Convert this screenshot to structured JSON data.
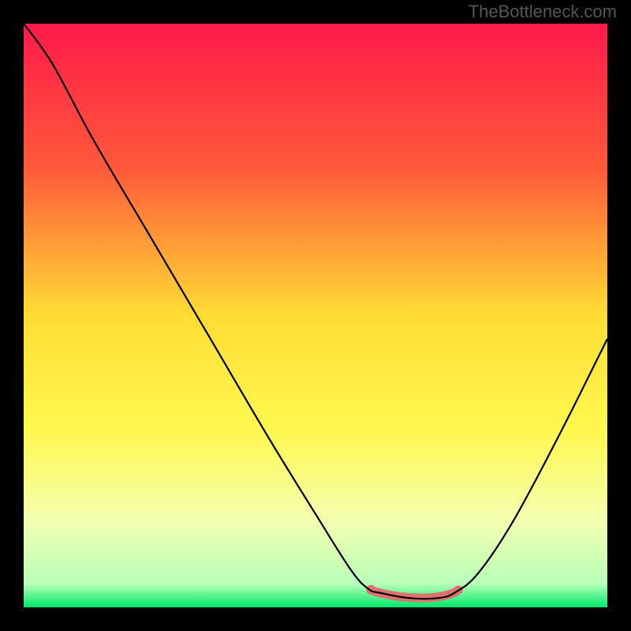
{
  "watermark": "TheBottleneck.com",
  "chart_data": {
    "type": "line",
    "title": "",
    "xlabel": "",
    "ylabel": "",
    "xlim": [
      0,
      100
    ],
    "ylim": [
      0,
      100
    ],
    "gradient_stops": [
      {
        "offset": 0,
        "color": "#ff1a4a"
      },
      {
        "offset": 25,
        "color": "#ff5a3a"
      },
      {
        "offset": 50,
        "color": "#ffdd33"
      },
      {
        "offset": 70,
        "color": "#fff850"
      },
      {
        "offset": 85,
        "color": "#f4ffb0"
      },
      {
        "offset": 96,
        "color": "#b8ffb8"
      },
      {
        "offset": 100,
        "color": "#00e96a"
      }
    ],
    "series": [
      {
        "name": "curve",
        "color": "#000000",
        "width": 2.2,
        "points": [
          {
            "x": 0,
            "y": 100
          },
          {
            "x": 5,
            "y": 93
          },
          {
            "x": 12,
            "y": 80
          },
          {
            "x": 22,
            "y": 63
          },
          {
            "x": 32,
            "y": 46
          },
          {
            "x": 42,
            "y": 29
          },
          {
            "x": 50,
            "y": 16
          },
          {
            "x": 56,
            "y": 6.5
          },
          {
            "x": 59,
            "y": 3.2
          },
          {
            "x": 61,
            "y": 2.5
          },
          {
            "x": 66,
            "y": 1.6
          },
          {
            "x": 71,
            "y": 1.6
          },
          {
            "x": 74,
            "y": 2.6
          },
          {
            "x": 78,
            "y": 6
          },
          {
            "x": 84,
            "y": 15
          },
          {
            "x": 92,
            "y": 30
          },
          {
            "x": 100,
            "y": 46
          }
        ]
      },
      {
        "name": "highlight",
        "color": "#e07070",
        "width": 11,
        "cap": "round",
        "points": [
          {
            "x": 59.5,
            "y": 3.0
          },
          {
            "x": 60.5,
            "y": 2.6
          },
          {
            "x": 64,
            "y": 1.9
          },
          {
            "x": 68,
            "y": 1.6
          },
          {
            "x": 71,
            "y": 1.8
          },
          {
            "x": 73.5,
            "y": 2.4
          },
          {
            "x": 74.5,
            "y": 3.0
          }
        ]
      }
    ],
    "dot": {
      "x": 59.5,
      "y": 3.0,
      "r": 6,
      "color": "#e07070"
    }
  }
}
